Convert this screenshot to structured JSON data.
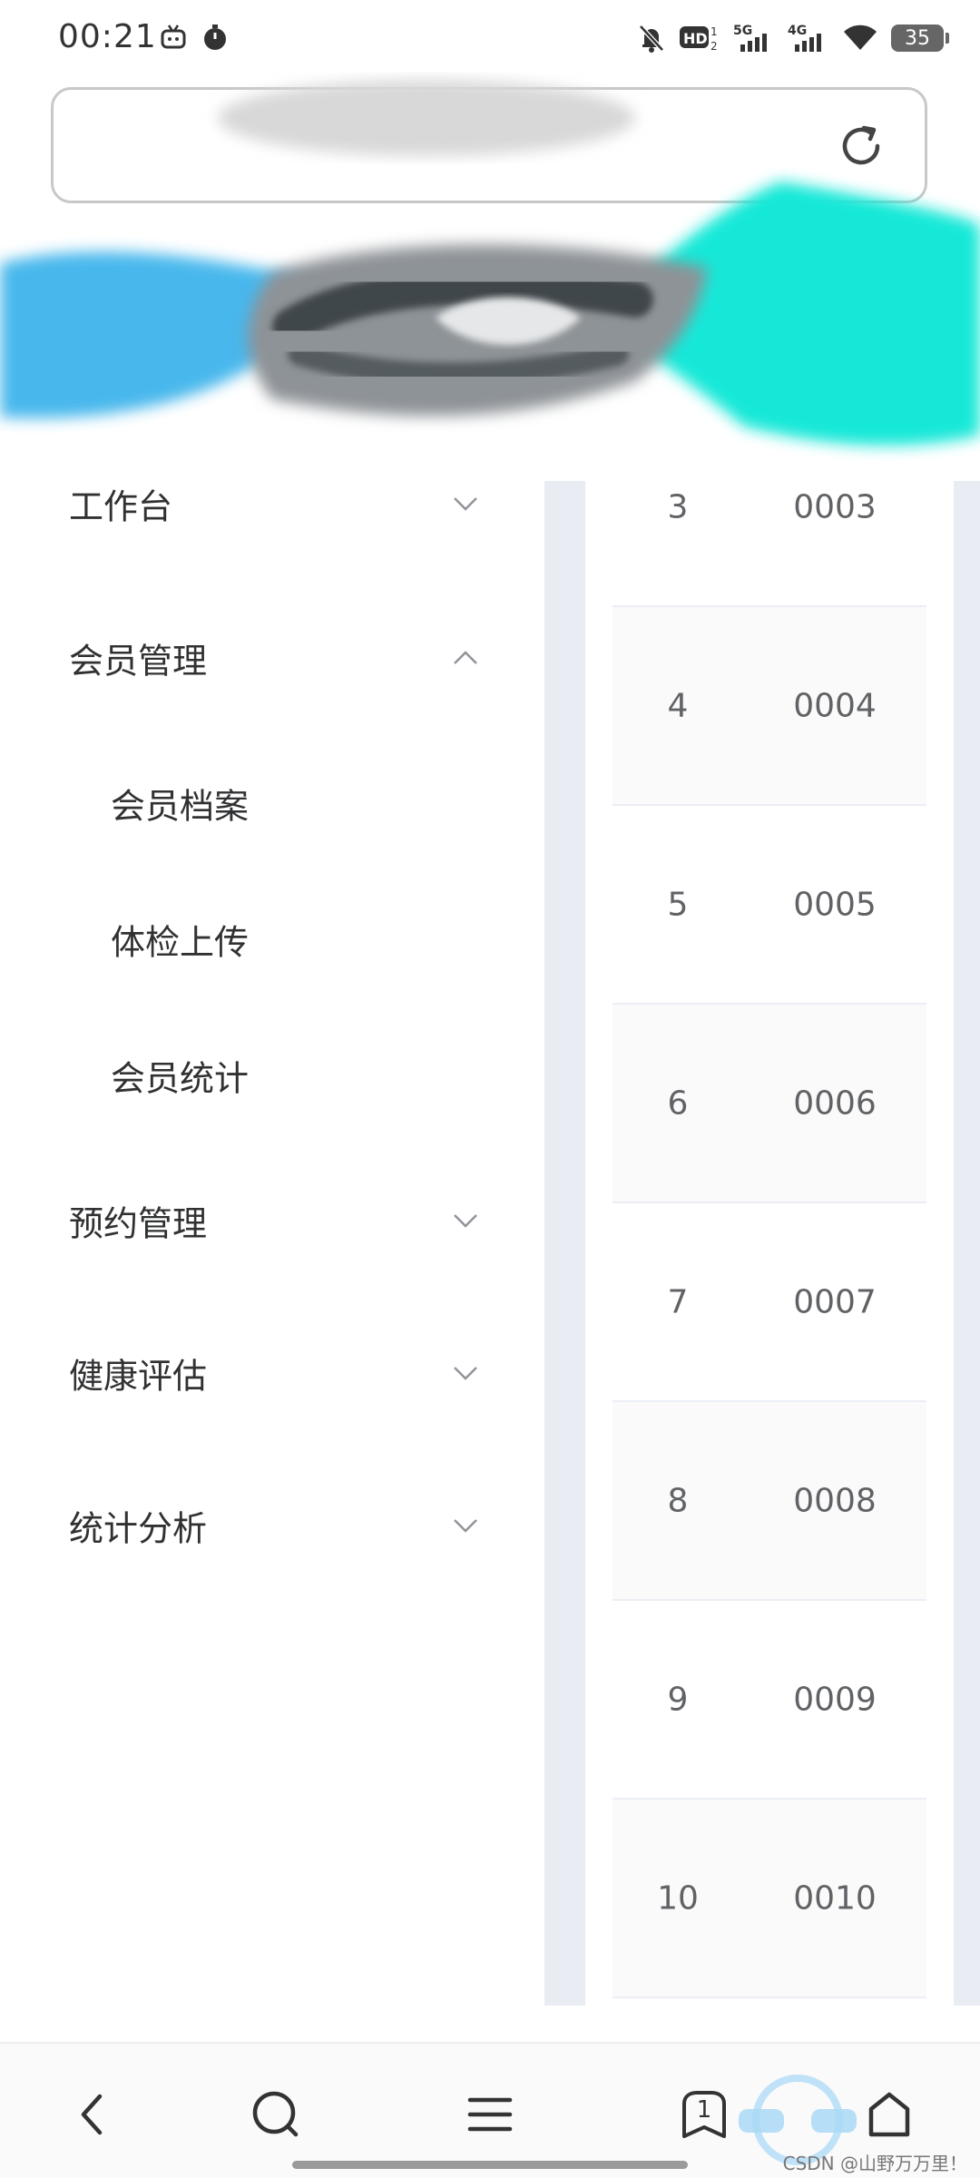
{
  "status_bar": {
    "time": "00:21",
    "battery": "35",
    "icons": [
      "tv-icon",
      "timer-icon",
      "mute-bell-icon",
      "hd-icon",
      "signal-5g-icon",
      "signal-4g-icon",
      "wifi-icon",
      "battery-icon"
    ]
  },
  "address_bar": {
    "url": "",
    "reload_icon": "reload-icon"
  },
  "side_menu": {
    "items": [
      {
        "label": "工作台",
        "expanded": false
      },
      {
        "label": "会员管理",
        "expanded": true
      },
      {
        "label": "会员档案",
        "sub": true
      },
      {
        "label": "体检上传",
        "sub": true
      },
      {
        "label": "会员统计",
        "sub": true
      },
      {
        "label": "预约管理",
        "expanded": false
      },
      {
        "label": "健康评估",
        "expanded": false
      },
      {
        "label": "统计分析",
        "expanded": false
      }
    ]
  },
  "table": {
    "rows": [
      {
        "index": "3",
        "code": "0003"
      },
      {
        "index": "4",
        "code": "0004"
      },
      {
        "index": "5",
        "code": "0005"
      },
      {
        "index": "6",
        "code": "0006"
      },
      {
        "index": "7",
        "code": "0007"
      },
      {
        "index": "8",
        "code": "0008"
      },
      {
        "index": "9",
        "code": "0009"
      },
      {
        "index": "10",
        "code": "0010"
      }
    ]
  },
  "nav_bar": {
    "buttons": [
      "back-icon",
      "search-icon",
      "menu-icon",
      "tabs-icon",
      "home-icon"
    ],
    "tab_count": "1"
  },
  "watermark": "CSDN @山野万万里！",
  "colors": {
    "menu_text": "#303133",
    "table_text": "#606266",
    "panel_bg": "#e9ecf2",
    "stripe_bg": "#fafafa"
  }
}
